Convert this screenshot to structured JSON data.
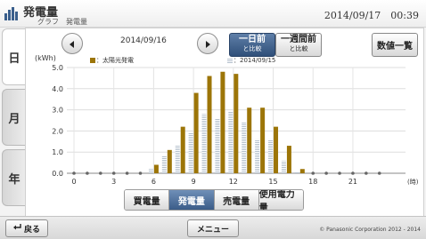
{
  "header": {
    "title": "発電量",
    "breadcrumb": "グラフ　発電量",
    "datetime": "2014/09/17　00:39"
  },
  "side_tabs": [
    {
      "label": "日",
      "active": true
    },
    {
      "label": "月",
      "active": false
    },
    {
      "label": "年",
      "active": false
    }
  ],
  "nav": {
    "date": "2014/09/16",
    "compare_day_label": "一日前",
    "compare_day_sub": "と比較",
    "compare_week_label": "一週間前",
    "compare_week_sub": "と比較",
    "list_button": "数値一覧"
  },
  "legend": {
    "series1": "：太陽光発電",
    "series2": "：2014/09/15"
  },
  "bottom_tabs": [
    {
      "label": "買電量",
      "active": false
    },
    {
      "label": "発電量",
      "active": true
    },
    {
      "label": "売電量",
      "active": false
    },
    {
      "label": "使用電力量",
      "active": false
    }
  ],
  "footer": {
    "back_label": "戻る",
    "menu_label": "メニュー",
    "copyright": "© Panasonic Corporation 2012 - 2014"
  },
  "colors": {
    "series1": "#9c7508",
    "series2": "#b4c0cc",
    "active_tab": "#3b5c88"
  },
  "chart_data": {
    "type": "bar",
    "ylabel": "(kWh)",
    "xunit": "(時)",
    "ylim": [
      0,
      5.0
    ],
    "yticks": [
      "0.0",
      "1.0",
      "2.0",
      "3.0",
      "4.0",
      "5.0"
    ],
    "xticks": [
      "0",
      "3",
      "6",
      "9",
      "12",
      "15",
      "18",
      "21"
    ],
    "x": [
      0,
      1,
      2,
      3,
      4,
      5,
      6,
      7,
      8,
      9,
      10,
      11,
      12,
      13,
      14,
      15,
      16,
      17,
      18,
      19,
      20,
      21,
      22,
      23
    ],
    "series": [
      {
        "name": "太陽光発電",
        "values": [
          0,
          0,
          0,
          0,
          0,
          0,
          0.4,
          1.1,
          2.2,
          3.8,
          4.6,
          4.8,
          4.7,
          3.1,
          3.1,
          2.2,
          1.3,
          0.2,
          0,
          0,
          0,
          0,
          0,
          0
        ]
      },
      {
        "name": "2014/09/15",
        "values": [
          0,
          0,
          0,
          0,
          0,
          0,
          0.2,
          0.8,
          1.3,
          1.9,
          2.8,
          2.6,
          2.9,
          2.4,
          1.6,
          1.6,
          0.6,
          0.05,
          0,
          0,
          0,
          0,
          0,
          0
        ]
      }
    ]
  }
}
